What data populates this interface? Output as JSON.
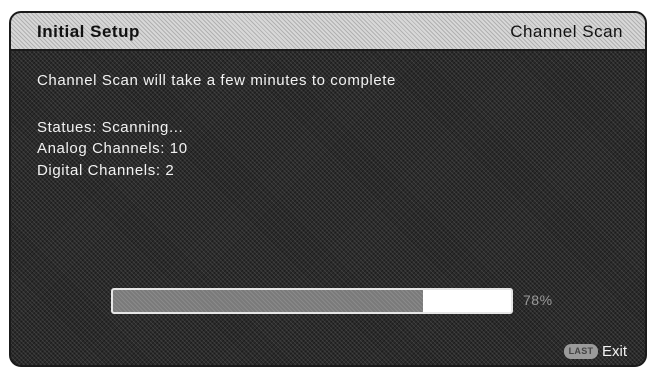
{
  "header": {
    "title": "Initial Setup",
    "section": "Channel Scan"
  },
  "main": {
    "message": "Channel Scan will take a few minutes to complete",
    "status": "Statues: Scanning...",
    "analog": "Analog Channels: 10",
    "digital": "Digital Channels: 2"
  },
  "progress": {
    "value": 0.78,
    "label": "78%"
  },
  "footer": {
    "key_label": "LAST",
    "exit_label": "Exit"
  }
}
